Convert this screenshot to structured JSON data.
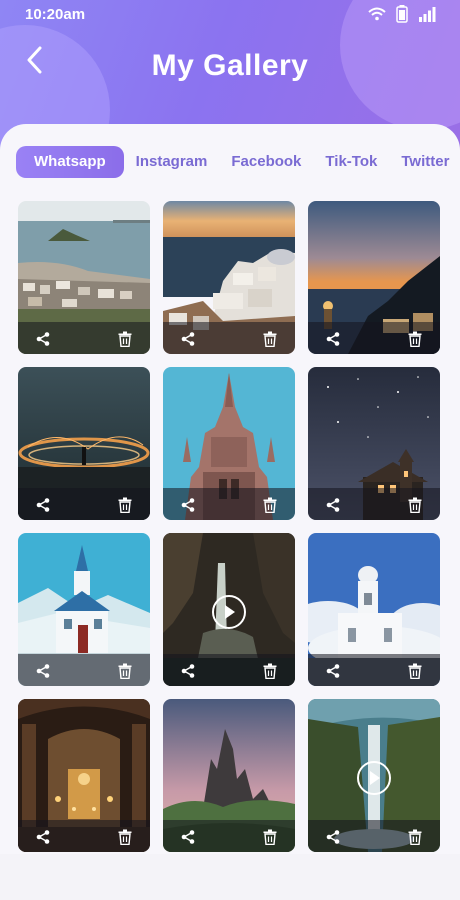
{
  "status_bar": {
    "time": "10:20am",
    "icons": [
      "wifi-icon",
      "battery-icon",
      "signal-icon"
    ]
  },
  "header": {
    "title": "My Gallery",
    "back_icon": "back-chevron-icon"
  },
  "tabs": [
    {
      "label": "Whatsapp",
      "active": true
    },
    {
      "label": "Instagram",
      "active": false
    },
    {
      "label": "Facebook",
      "active": false
    },
    {
      "label": "Tik-Tok",
      "active": false
    },
    {
      "label": "Twitter",
      "active": false
    }
  ],
  "colors": {
    "accent": "#8b73f0",
    "tab_text": "#7a6bd3",
    "card_bg": "#f7f6fb"
  },
  "gallery": {
    "items": [
      {
        "scene": "island-coastal-town",
        "type": "photo"
      },
      {
        "scene": "santorini-sunset",
        "type": "photo"
      },
      {
        "scene": "coastal-dusk-village",
        "type": "photo"
      },
      {
        "scene": "steel-wool-sparks",
        "type": "photo"
      },
      {
        "scene": "gothic-cathedral",
        "type": "photo"
      },
      {
        "scene": "starry-night-church",
        "type": "photo"
      },
      {
        "scene": "snowy-blue-church",
        "type": "photo"
      },
      {
        "scene": "forest-waterfall",
        "type": "video"
      },
      {
        "scene": "white-church-clouds",
        "type": "photo"
      },
      {
        "scene": "church-interior-altar",
        "type": "photo"
      },
      {
        "scene": "rocky-mountain-peaks",
        "type": "photo"
      },
      {
        "scene": "canyon-waterfall",
        "type": "video"
      }
    ],
    "actions": {
      "share_icon": "share-icon",
      "delete_icon": "trash-icon",
      "play_icon": "play-icon"
    }
  }
}
